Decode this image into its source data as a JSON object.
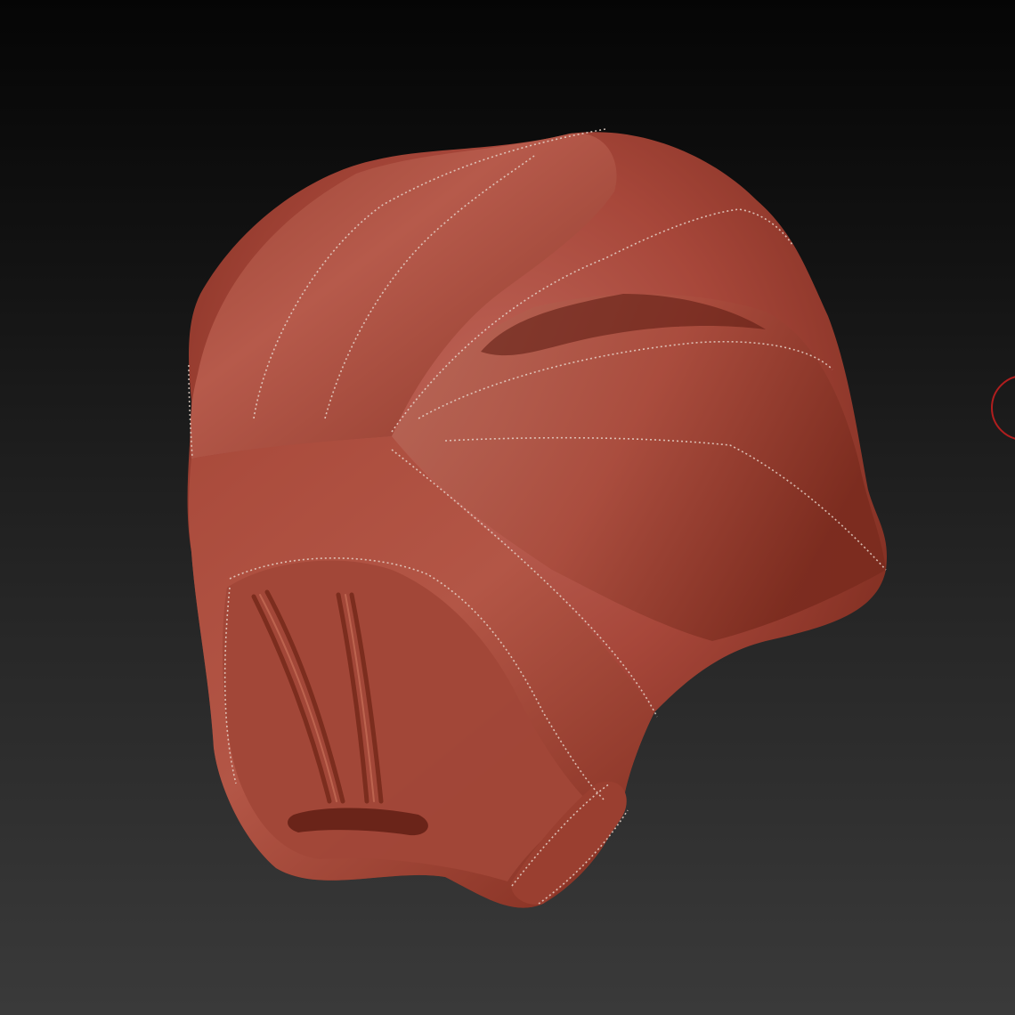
{
  "viewport": {
    "background_top": "#050505",
    "background_bottom": "#3a3a3a"
  },
  "model": {
    "object": "sculpted-helmet-mask",
    "material_color": "#a7473a",
    "seam_color": "#e6d3c9"
  },
  "overlay": {
    "partial_ui_circle_color": "#b01e1e"
  }
}
